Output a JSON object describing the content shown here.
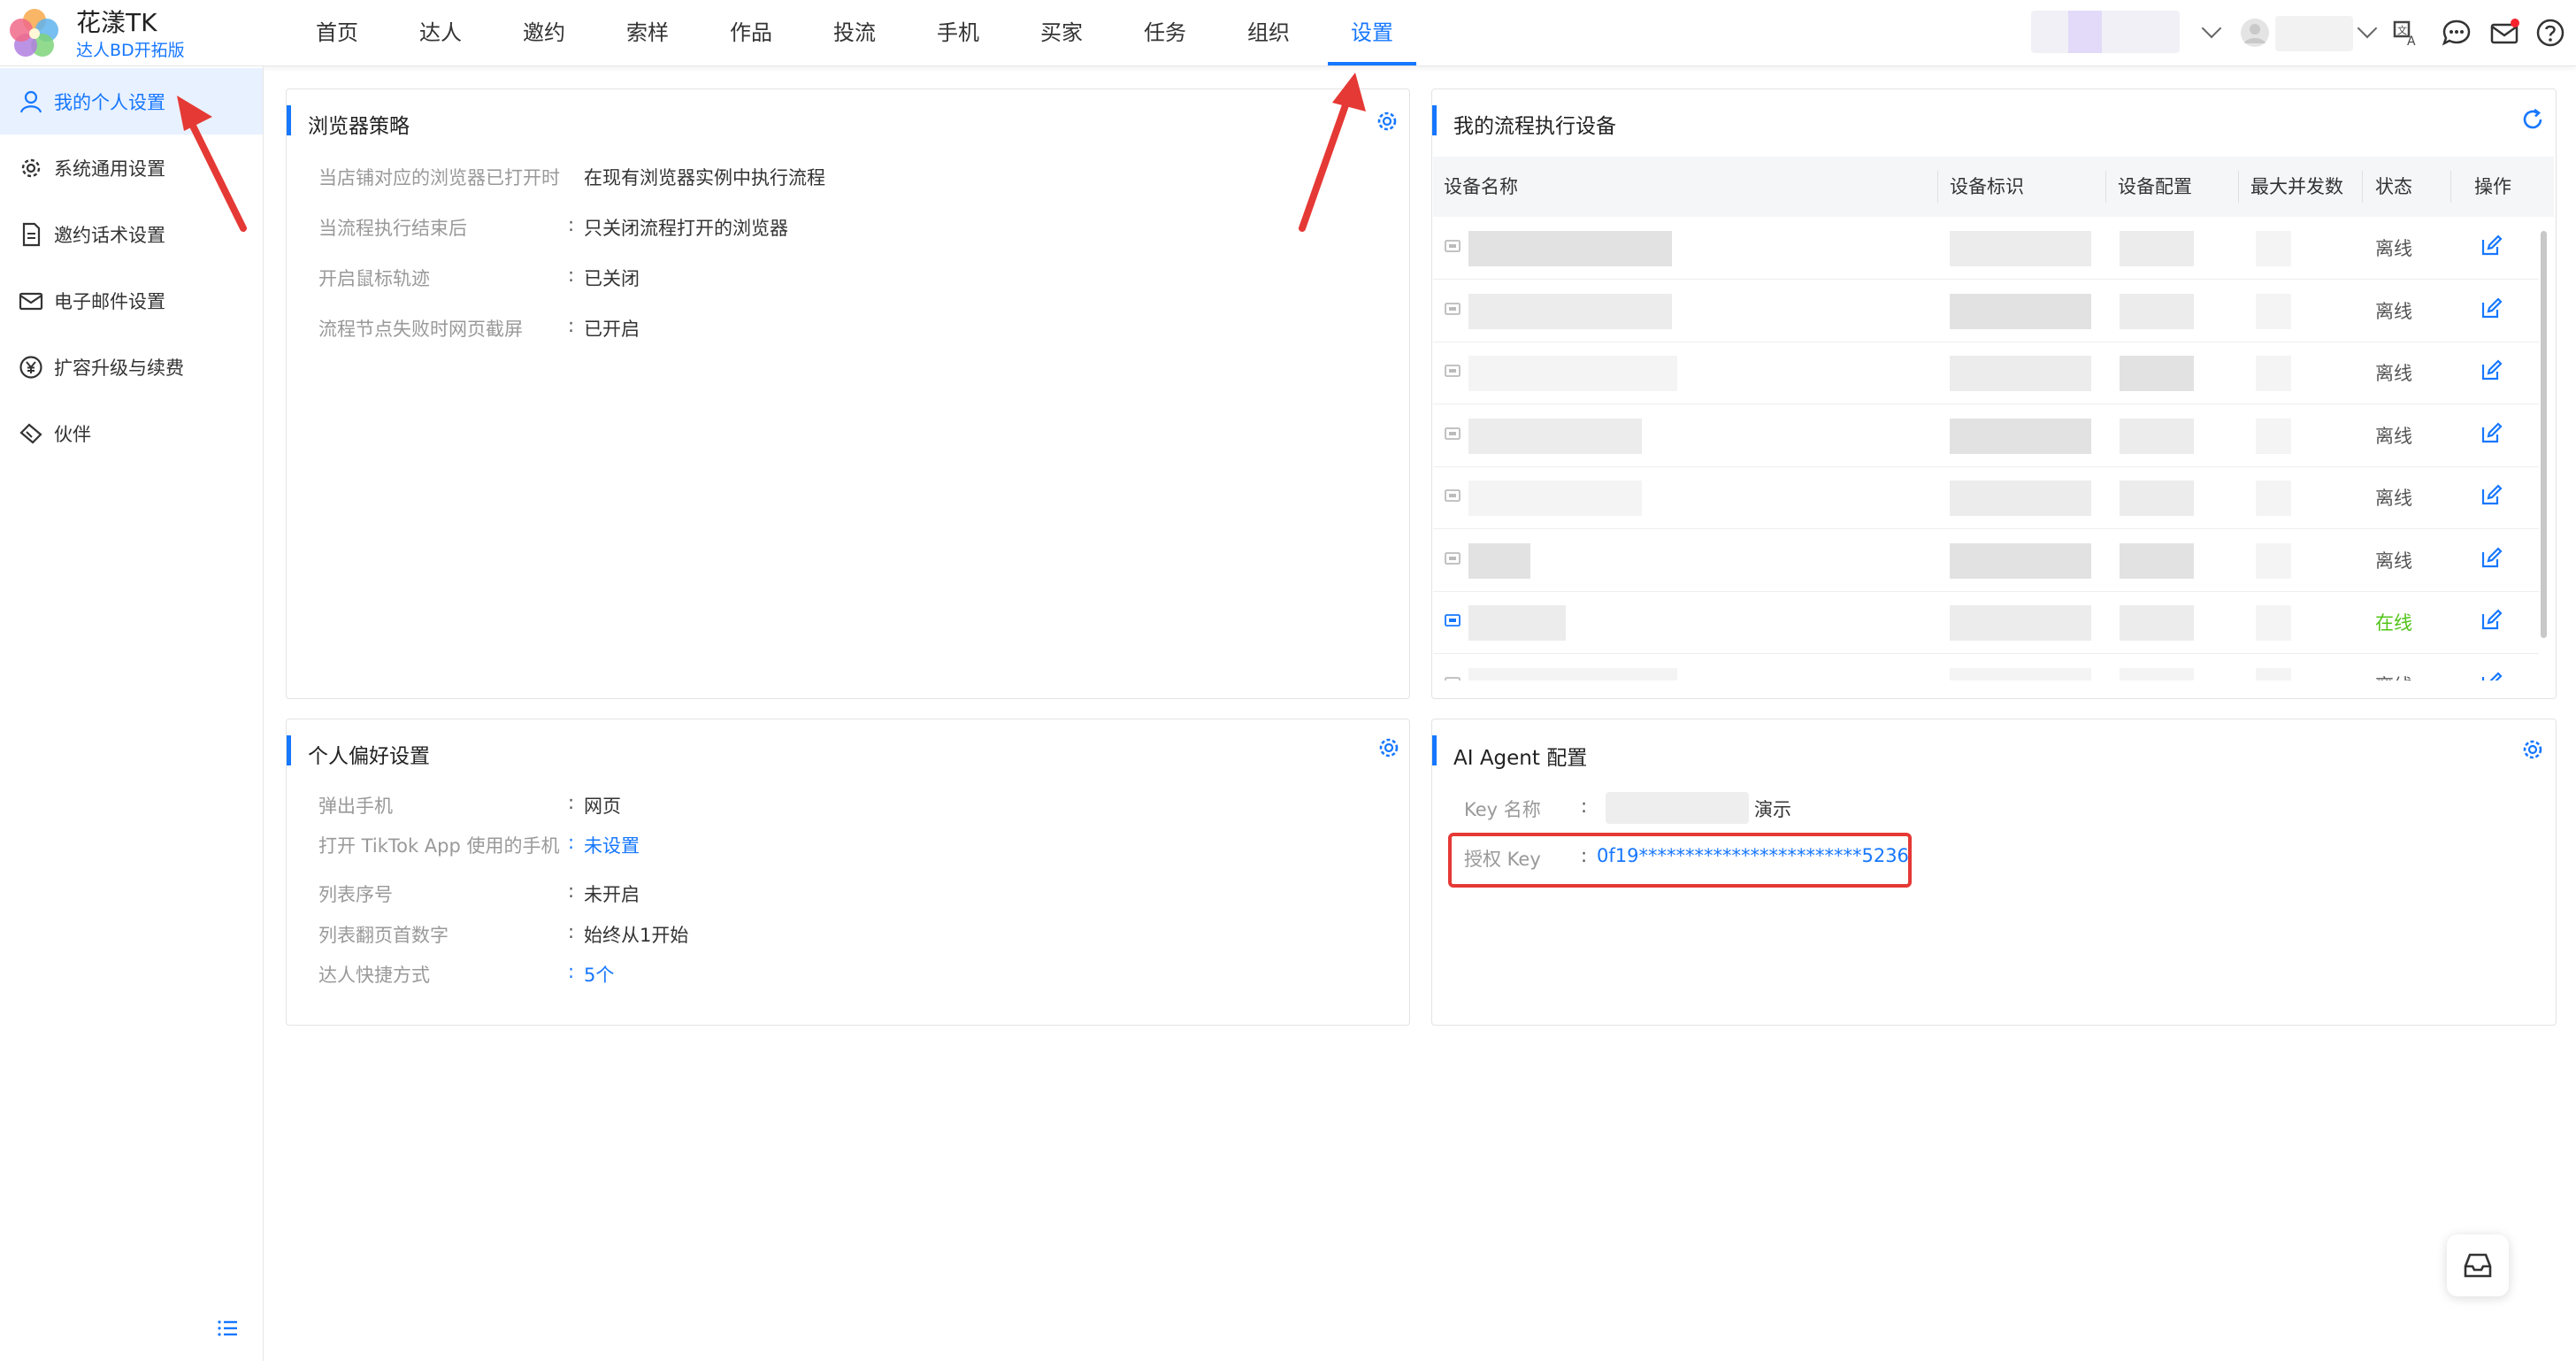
{
  "app": {
    "title": "花漾TK",
    "subtitle": "达人BD开拓版"
  },
  "nav": [
    "首页",
    "达人",
    "邀约",
    "索样",
    "作品",
    "投流",
    "手机",
    "买家",
    "任务",
    "组织",
    "设置"
  ],
  "nav_active": "设置",
  "sidebar": {
    "items": [
      {
        "label": "我的个人设置",
        "icon": "user-icon",
        "active": true
      },
      {
        "label": "系统通用设置",
        "icon": "gear-icon",
        "active": false
      },
      {
        "label": "邀约话术设置",
        "icon": "document-icon",
        "active": false
      },
      {
        "label": "电子邮件设置",
        "icon": "mail-icon",
        "active": false
      },
      {
        "label": "扩容升级与续费",
        "icon": "yen-circle-icon",
        "active": false
      },
      {
        "label": "伙伴",
        "icon": "handshake-icon",
        "active": false
      }
    ]
  },
  "browser_policy": {
    "title": "浏览器策略",
    "rows": [
      {
        "label": "当店铺对应的浏览器已打开时",
        "value": "在现有浏览器实例中执行流程"
      },
      {
        "label": "当流程执行结束后",
        "value": "只关闭流程打开的浏览器"
      },
      {
        "label": "开启鼠标轨迹",
        "value": "已关闭"
      },
      {
        "label": "流程节点失败时网页截屏",
        "value": "已开启"
      }
    ]
  },
  "devices": {
    "title": "我的流程执行设备",
    "columns": [
      "设备名称",
      "设备标识",
      "设备配置",
      "最大并发数",
      "状态",
      "操作"
    ],
    "rows": [
      {
        "status": "离线"
      },
      {
        "status": "离线"
      },
      {
        "status": "离线"
      },
      {
        "status": "离线"
      },
      {
        "status": "离线"
      },
      {
        "status": "离线"
      },
      {
        "status": "在线"
      },
      {
        "status": "离线"
      }
    ],
    "status_colors": {
      "离线": "#555555",
      "在线": "#52c41a"
    }
  },
  "preferences": {
    "title": "个人偏好设置",
    "rows": [
      {
        "label": "弹出手机",
        "value": "网页",
        "link": false
      },
      {
        "label": "打开 TikTok App 使用的手机",
        "value": "未设置",
        "link": true
      },
      {
        "label": "列表序号",
        "value": "未开启",
        "link": false
      },
      {
        "label": "列表翻页首数字",
        "value": "始终从1开始",
        "link": false
      },
      {
        "label": "达人快捷方式",
        "value": "5个",
        "link": true
      }
    ]
  },
  "ai_agent": {
    "title": "AI Agent 配置",
    "key_name_label": "Key 名称",
    "key_name_value": "演示",
    "auth_key_label": "授权 Key",
    "auth_key_value": "0f19************************5236"
  },
  "colors": {
    "accent": "#1677ff",
    "highlight": "#e53935"
  }
}
